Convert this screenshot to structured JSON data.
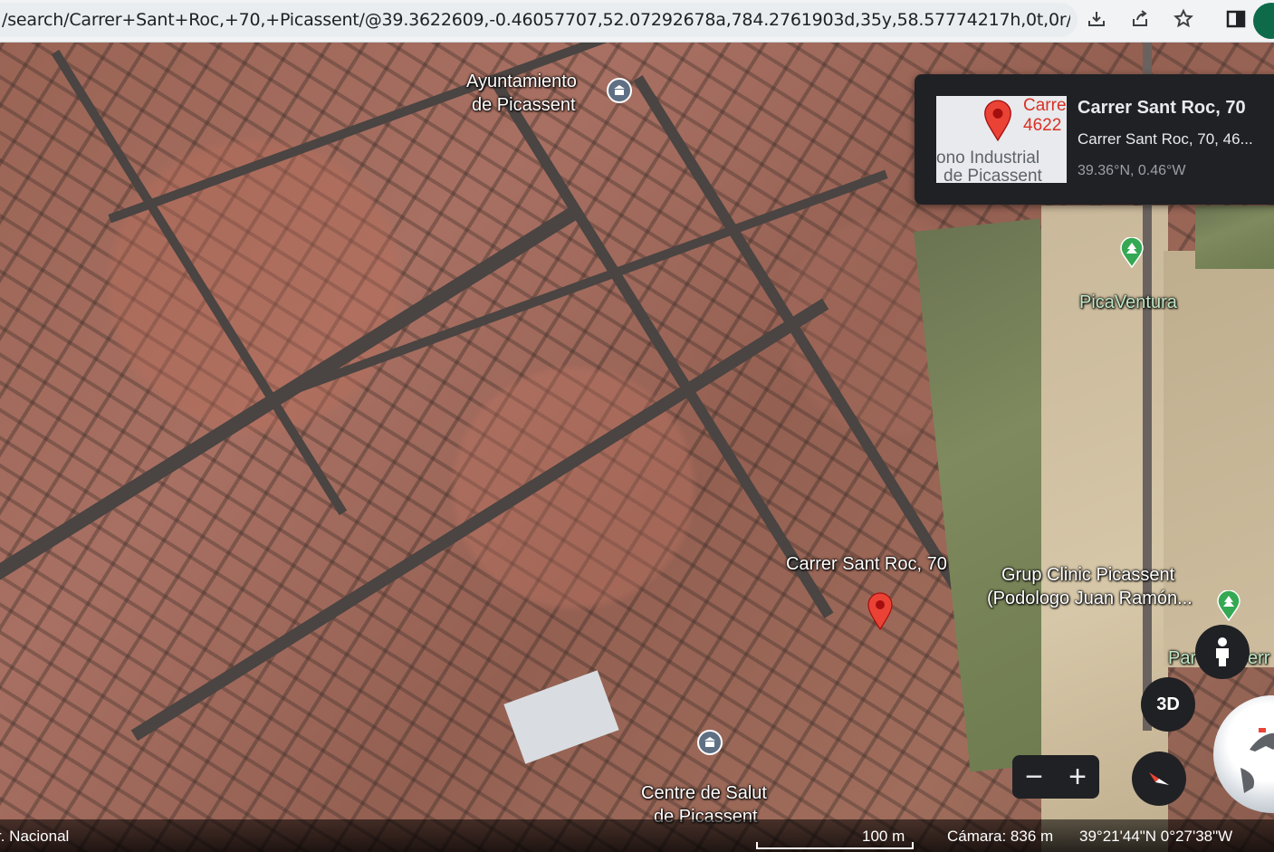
{
  "browser": {
    "url": "/search/Carrer+Sant+Roc,+70,+Picassent/@39.3622609,-0.46057707,52.07292678a,784.2761903d,35y,58.57774217h,0t,0r/dat...",
    "icons": [
      "download-icon",
      "share-icon",
      "bookmark-star-icon",
      "sidebar-icon",
      "profile-icon"
    ]
  },
  "map": {
    "labels": {
      "ayuntamiento_line1": "Ayuntamiento",
      "ayuntamiento_line2": "de Picassent",
      "picaventura": "PicaVentura",
      "selected_address": "Carrer Sant Roc, 70",
      "grup_clinic_line1": "Grup Clinic Picassent",
      "grup_clinic_line2": "(Podologo Juan Ramón...",
      "park_partial": "Par",
      "park_partial_end": "err",
      "centre_salut_line1": "Centre de Salut",
      "centre_salut_line2": "de Picassent"
    }
  },
  "card": {
    "thumb_line1": "Carre",
    "thumb_line2": "4622",
    "thumb_line3": "ono Industrial",
    "thumb_line4": "de Picassent",
    "title": "Carrer Sant Roc, 70",
    "subtitle": "Carrer Sant Roc, 70, 46...",
    "coords": "39.36°N, 0.46°W"
  },
  "controls": {
    "view_3d": "3D",
    "zoom_out": "−",
    "zoom_in": "+"
  },
  "status": {
    "left": "r. Nacional",
    "scale": "100 m",
    "camera": "Cámara: 836 m",
    "coords": "39°21'44\"N 0°27'38\"W"
  },
  "colors": {
    "pin_red": "#ea4335",
    "card_bg": "#202124",
    "park_green": "#34a853"
  }
}
